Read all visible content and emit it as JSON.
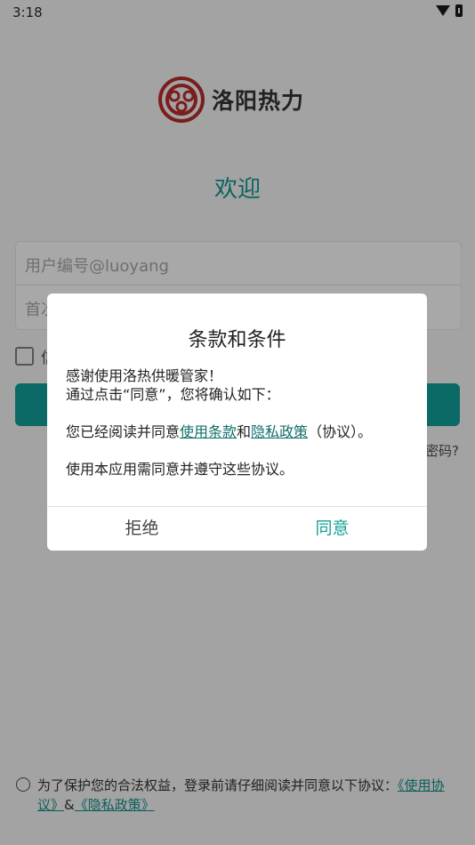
{
  "status_bar": {
    "time": "3:18"
  },
  "app": {
    "name": "洛阳热力",
    "welcome": "欢迎"
  },
  "login_form": {
    "user_id_placeholder": "用户编号@luoyang",
    "password_placeholder_partial": "首次",
    "remember_label_partial": "信",
    "forgot_partial": "密码?"
  },
  "agreement": {
    "text_before": "为了保护您的合法权益，登录前请仔细阅读并同意以下协议：",
    "link_terms": "《使用协议》",
    "ampersand": "&",
    "link_privacy": "《隐私政策》"
  },
  "dialog": {
    "title": "条款和条件",
    "line1": "感谢使用洛热供暖管家！",
    "line2": "通过点击“同意”，您将确认如下：",
    "line3_prefix": "您已经阅读并同意",
    "terms_link": "使用条款",
    "and": "和",
    "privacy_link": "隐私政策",
    "line3_suffix": "（协议）。",
    "line4": "使用本应用需同意并遵守这些协议。",
    "reject_label": "拒绝",
    "agree_label": "同意"
  },
  "colors": {
    "primary": "#0c6a66",
    "accent_agree": "#15a097",
    "overlay": "#a3a3a3"
  }
}
